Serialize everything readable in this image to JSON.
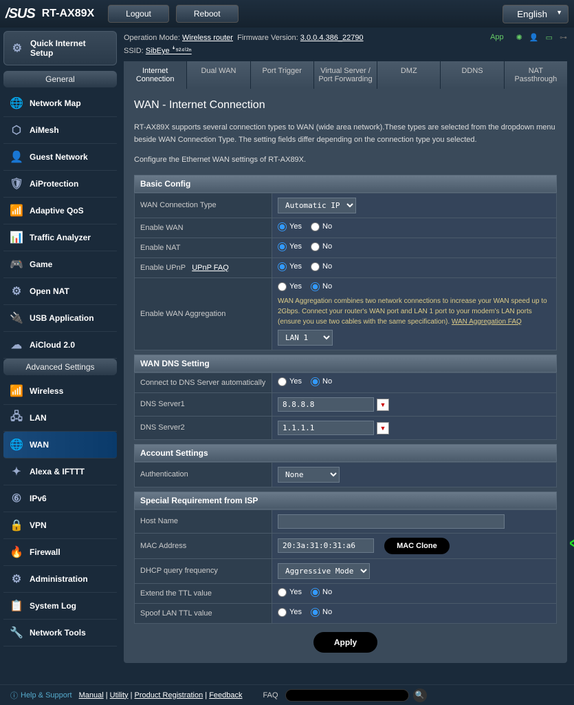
{
  "header": {
    "brand": "/SUS",
    "model": "RT-AX89X",
    "logout": "Logout",
    "reboot": "Reboot",
    "language": "English"
  },
  "status": {
    "op_mode_label": "Operation Mode:",
    "op_mode_value": "Wireless router",
    "fw_label": "Firmware Version:",
    "fw_value": "3.0.0.4.386_22790",
    "ssid_label": "SSID:",
    "ssid_value": "SibEye ꜜ⁹²⁴⁽²ⁿ",
    "app": "App"
  },
  "sidebar": {
    "qis": "Quick Internet Setup",
    "general_label": "General",
    "advanced_label": "Advanced Settings",
    "general": [
      {
        "label": "Network Map",
        "icon": "🌐"
      },
      {
        "label": "AiMesh",
        "icon": "⬡"
      },
      {
        "label": "Guest Network",
        "icon": "👤"
      },
      {
        "label": "AiProtection",
        "icon": "🛡"
      },
      {
        "label": "Adaptive QoS",
        "icon": "📶"
      },
      {
        "label": "Traffic Analyzer",
        "icon": "📊"
      },
      {
        "label": "Game",
        "icon": "🎮"
      },
      {
        "label": "Open NAT",
        "icon": "⚙"
      },
      {
        "label": "USB Application",
        "icon": "🔌"
      },
      {
        "label": "AiCloud 2.0",
        "icon": "☁"
      }
    ],
    "advanced": [
      {
        "label": "Wireless",
        "icon": "📶"
      },
      {
        "label": "LAN",
        "icon": "🖧"
      },
      {
        "label": "WAN",
        "icon": "🌐",
        "active": true
      },
      {
        "label": "Alexa & IFTTT",
        "icon": "✦"
      },
      {
        "label": "IPv6",
        "icon": "⑥"
      },
      {
        "label": "VPN",
        "icon": "🔒"
      },
      {
        "label": "Firewall",
        "icon": "🔥"
      },
      {
        "label": "Administration",
        "icon": "⚙"
      },
      {
        "label": "System Log",
        "icon": "📋"
      },
      {
        "label": "Network Tools",
        "icon": "🔧"
      }
    ]
  },
  "tabs": [
    "Internet Connection",
    "Dual WAN",
    "Port Trigger",
    "Virtual Server / Port Forwarding",
    "DMZ",
    "DDNS",
    "NAT Passthrough"
  ],
  "page": {
    "title": "WAN - Internet Connection",
    "desc1": "RT-AX89X supports several connection types to WAN (wide area network).These types are selected from the dropdown menu beside WAN Connection Type. The setting fields differ depending on the connection type you selected.",
    "desc2": "Configure the Ethernet WAN settings of RT-AX89X."
  },
  "sections": {
    "basic": "Basic Config",
    "dns": "WAN DNS Setting",
    "account": "Account Settings",
    "special": "Special Requirement from ISP"
  },
  "fields": {
    "wan_type_label": "WAN Connection Type",
    "wan_type_value": "Automatic IP",
    "enable_wan": "Enable WAN",
    "enable_nat": "Enable NAT",
    "enable_upnp": "Enable UPnP",
    "upnp_faq": "UPnP FAQ",
    "enable_agg": "Enable WAN Aggregation",
    "agg_hint": "WAN Aggregation combines two network connections to increase your WAN speed up to 2Gbps. Connect your router's WAN port and LAN 1 port to your modem's LAN ports (ensure you use two cables with the same specification).",
    "agg_faq": "WAN Aggregation FAQ",
    "agg_port": "LAN 1",
    "dns_auto": "Connect to DNS Server automatically",
    "dns1_label": "DNS Server1",
    "dns1_value": "8.8.8.8",
    "dns2_label": "DNS Server2",
    "dns2_value": "1.1.1.1",
    "auth_label": "Authentication",
    "auth_value": "None",
    "host_label": "Host Name",
    "host_value": "",
    "mac_label": "MAC Address",
    "mac_value": "20:3a:31:0:31:a6",
    "mac_clone": "MAC Clone",
    "dhcp_freq_label": "DHCP query frequency",
    "dhcp_freq_value": "Aggressive Mode",
    "ttl_extend": "Extend the TTL value",
    "ttl_spoof": "Spoof LAN TTL value",
    "yes": "Yes",
    "no": "No",
    "apply": "Apply"
  },
  "footer": {
    "help": "Help & Support",
    "manual": "Manual",
    "utility": "Utility",
    "reg": "Product Registration",
    "feedback": "Feedback",
    "faq": "FAQ"
  }
}
